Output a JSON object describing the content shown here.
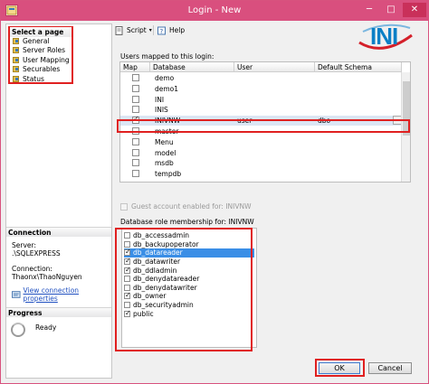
{
  "window": {
    "title": "Login - New",
    "controls": {
      "minimize": "─",
      "maximize": "□",
      "close": "✕"
    }
  },
  "logo": {
    "text": "INI",
    "colors": {
      "blue": "#0a7fc6",
      "red": "#d4202a"
    }
  },
  "left_pane": {
    "select_page_header": "Select a page",
    "pages": [
      "General",
      "Server Roles",
      "User Mapping",
      "Securables",
      "Status"
    ],
    "connection": {
      "header": "Connection",
      "server_label": "Server:",
      "server_value": ".\\SQLEXPRESS",
      "connection_label": "Connection:",
      "connection_value": "Thaonx\\ThaoNguyen",
      "link": "View connection properties"
    },
    "progress": {
      "header": "Progress",
      "status": "Ready"
    }
  },
  "toolbar": {
    "script": "Script",
    "help": "Help"
  },
  "users_mapped": {
    "label": "Users mapped to this login:",
    "columns": [
      "Map",
      "Database",
      "User",
      "Default Schema"
    ],
    "rows": [
      {
        "map": false,
        "database": "demo",
        "user": "",
        "schema": ""
      },
      {
        "map": false,
        "database": "demo1",
        "user": "",
        "schema": ""
      },
      {
        "map": false,
        "database": "INI",
        "user": "",
        "schema": ""
      },
      {
        "map": false,
        "database": "INIS",
        "user": "",
        "schema": ""
      },
      {
        "map": true,
        "database": "INIVNW",
        "user": "user",
        "schema": "dbo",
        "selected": true
      },
      {
        "map": false,
        "database": "master",
        "user": "",
        "schema": ""
      },
      {
        "map": false,
        "database": "Menu",
        "user": "",
        "schema": ""
      },
      {
        "map": false,
        "database": "model",
        "user": "",
        "schema": ""
      },
      {
        "map": false,
        "database": "msdb",
        "user": "",
        "schema": ""
      },
      {
        "map": false,
        "database": "tempdb",
        "user": "",
        "schema": ""
      }
    ],
    "ellipsis": "..."
  },
  "guest": {
    "label": "Guest account enabled for: INIVNW",
    "checked": false
  },
  "db_roles": {
    "label": "Database role membership for: INIVNW",
    "items": [
      {
        "name": "db_accessadmin",
        "checked": false
      },
      {
        "name": "db_backupoperator",
        "checked": false
      },
      {
        "name": "db_datareader",
        "checked": true,
        "selected": true
      },
      {
        "name": "db_datawriter",
        "checked": true
      },
      {
        "name": "db_ddladmin",
        "checked": true
      },
      {
        "name": "db_denydatareader",
        "checked": false
      },
      {
        "name": "db_denydatawriter",
        "checked": false
      },
      {
        "name": "db_owner",
        "checked": true
      },
      {
        "name": "db_securityadmin",
        "checked": false
      },
      {
        "name": "public",
        "checked": true
      }
    ]
  },
  "buttons": {
    "ok": "OK",
    "cancel": "Cancel"
  },
  "colors": {
    "titlebar": "#d94f7e",
    "highlight_red": "#e02020",
    "selection_blue": "#3a8ee6"
  }
}
